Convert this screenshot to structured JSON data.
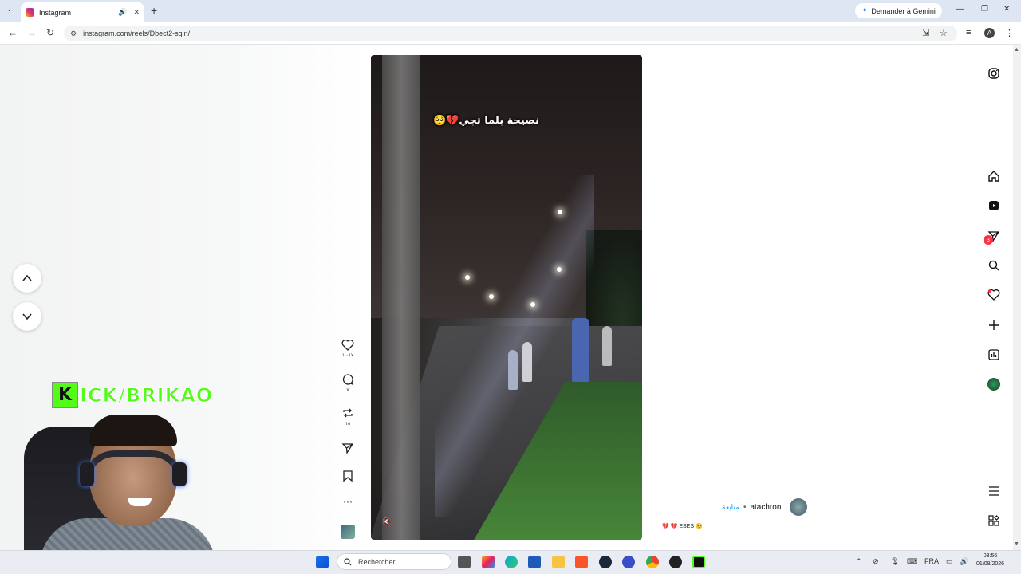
{
  "browser": {
    "tab_title": "Instagram",
    "url": "instagram.com/reels/Dbect2-sgjn/",
    "gemini_label": "Demander à Gemini",
    "profile_initial": "A"
  },
  "reel": {
    "caption": "نصيحة بلما تجي💔🥺",
    "likes": "١,٠١٧",
    "comments": "٧",
    "reposts": "١٥"
  },
  "post": {
    "author": "atachron",
    "follow_label": "متابعة",
    "separator": "•",
    "description": "💔 💔 ESES 🥺"
  },
  "sidebar": {
    "notification_count": "3"
  },
  "overlay": {
    "kick_letter": "K",
    "kick_text": "ICK/BRIKAO"
  },
  "taskbar": {
    "search_placeholder": "Rechercher",
    "language": "FRA",
    "time": "03:56",
    "date": "01/08/2026"
  },
  "colors": {
    "kick_green": "#53fc18",
    "notification_red": "#ff3040",
    "follow_blue": "#0095f6"
  }
}
